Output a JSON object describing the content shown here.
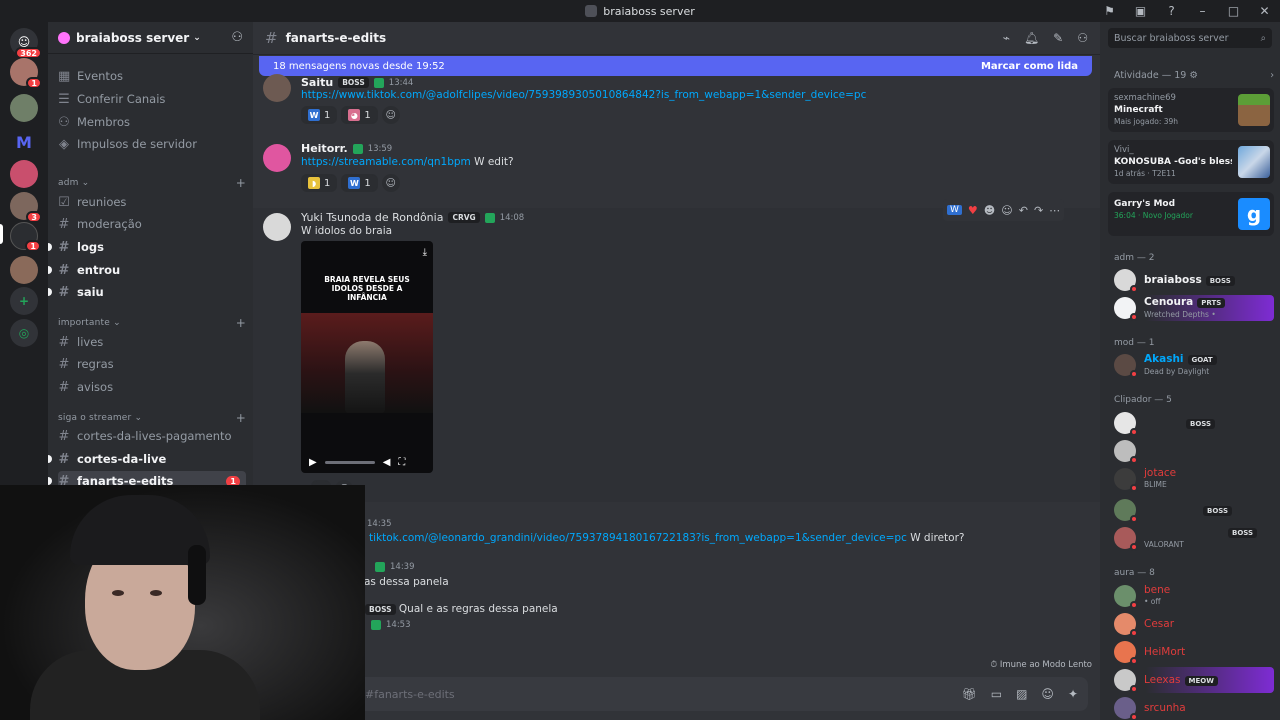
{
  "window": {
    "title": "braiaboss server"
  },
  "rail": {
    "badge_main": "362",
    "badge_1": "1",
    "badge_2": "3",
    "badge_3": "1",
    "badge_4": "1"
  },
  "sidebar": {
    "server_name": "braiaboss server",
    "items": [
      {
        "label": "Eventos"
      },
      {
        "label": "Conferir Canais"
      },
      {
        "label": "Membros"
      },
      {
        "label": "Impulsos de servidor"
      }
    ],
    "categories": [
      {
        "label": "adm",
        "channels": [
          "reunioes",
          "moderação",
          "logs",
          "entrou",
          "saiu"
        ]
      },
      {
        "label": "importante",
        "channels": [
          "lives",
          "regras",
          "avisos"
        ]
      },
      {
        "label": "siga o streamer",
        "channels": [
          "cortes-da-lives-pagamento",
          "cortes-da-live",
          "fanarts-e-edits"
        ]
      }
    ],
    "active_unread_count": "1"
  },
  "chat": {
    "channel": "fanarts-e-edits",
    "new_messages": "18 mensagens novas desde 19:52",
    "mark_read": "Marcar como lida",
    "messages": [
      {
        "user": "Saitu",
        "tag": "BOSS",
        "time": "13:44",
        "link": "https://www.tiktok.com/@adolfclipes/video/7593989305010864842?is_from_webapp=1&sender_device=pc",
        "reactions": [
          {
            "emoji": "W",
            "count": "1"
          },
          {
            "emoji": "pig",
            "count": "1"
          }
        ]
      },
      {
        "user": "Heitorr.",
        "time": "13:59",
        "link": "https://streamable.com/qn1bpm",
        "text": "W edit?",
        "reactions": [
          {
            "emoji": "banana",
            "count": "1"
          },
          {
            "emoji": "W",
            "count": "1"
          }
        ]
      },
      {
        "user": "Yuki Tsunoda de Rondônia",
        "tag": "CRVG",
        "time": "14:08",
        "text": "W idolos do braia",
        "video_caption": "BRAIA REVELA SEUS IDOLOS DESDE A INFÂNCIA",
        "reaction_count": "3"
      },
      {
        "time": "14:35",
        "link": "tiktok.com/@leonardo_grandini/video/7593789418016722183?is_from_webapp=1&sender_device=pc",
        "text": "W diretor?"
      },
      {
        "time": "14:39",
        "text": "as dessa panela"
      },
      {
        "tag": "BOSS",
        "text": "Qual e as regras dessa panela"
      },
      {
        "time": "14:53"
      }
    ],
    "slowmode": "Imune ao Modo Lento",
    "input_placeholder": "#fanarts-e-edits"
  },
  "members": {
    "search_placeholder": "Buscar braiaboss server",
    "activity_title": "Atividade — 19",
    "activity": [
      {
        "user": "sexmachine69",
        "game": "Minecraft",
        "status": "Mais jogado: 39h"
      },
      {
        "user": "Vivi_",
        "game": "KONOSUBA -God's blessin...",
        "status": "1d atrás · T2E11"
      },
      {
        "user": "",
        "game": "Garry's Mod",
        "status": "36:04 · Novo Jogador"
      }
    ],
    "groups": [
      {
        "label": "adm — 2"
      },
      {
        "label": "mod — 1"
      },
      {
        "label": "Clipador — 5"
      },
      {
        "label": "aura — 8"
      }
    ],
    "list": [
      {
        "name": "braiaboss",
        "tag": "BOSS",
        "color": "#f2f3f5"
      },
      {
        "name": "Cenoura",
        "tag": "PRTS",
        "sub": "Wretched Depths •",
        "color": "#f2f3f5"
      },
      {
        "name": "Akashi",
        "tag": "GOAT",
        "sub": "Dead by Daylight",
        "color": "#00a8fc"
      },
      {
        "name": "",
        "tag": "BOSS",
        "color": "#f2f3f5"
      },
      {
        "name": "",
        "color": "#f2f3f5"
      },
      {
        "name": "jotace",
        "sub": "BLIME",
        "color": "#e03c3c"
      },
      {
        "name": "",
        "tag": "BOSS",
        "color": "#f2f3f5"
      },
      {
        "name": "",
        "tag": "BOSS",
        "sub": "VALORANT",
        "color": "#f2f3f5"
      },
      {
        "name": "bene",
        "sub": "• off",
        "color": "#e03c3c"
      },
      {
        "name": "Cesar",
        "color": "#e03c3c"
      },
      {
        "name": "HeiMort",
        "color": "#e03c3c"
      },
      {
        "name": "Leexas",
        "tag": "MEOW",
        "color": "#e03c3c"
      },
      {
        "name": "srcunha",
        "color": "#e03c3c"
      }
    ]
  },
  "colors": {
    "accent": "#5865f2",
    "online": "#23a55a",
    "dnd": "#f23f43",
    "link": "#00a8fc"
  }
}
